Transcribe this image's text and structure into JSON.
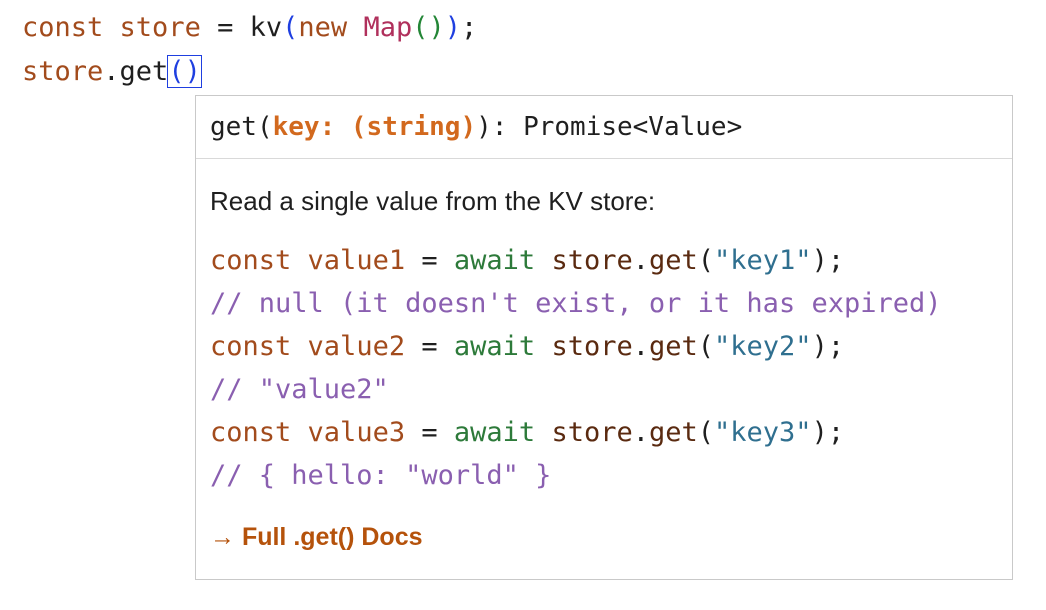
{
  "editor": {
    "line1": {
      "kw": "const",
      "var": "store",
      "eq": "=",
      "fn": "kv",
      "open_paren": "(",
      "new_kw": "new",
      "class_name": "Map",
      "inner_parens": "()",
      "close_paren": ")",
      "semicolon": ";"
    },
    "line2": {
      "obj": "store",
      "dot": ".",
      "method": "get",
      "parens": "()"
    }
  },
  "popup": {
    "signature": {
      "prefix": "get(",
      "param": "key: (string)",
      "suffix": "): Promise<Value>"
    },
    "description": "Read a single value from the KV store:",
    "example_lines": [
      {
        "type": "code",
        "kw": "const",
        "var": "value1",
        "eq": "=",
        "await": "await",
        "obj": "store",
        "dot": ".",
        "method": "get",
        "open": "(",
        "str": "\"key1\"",
        "close": ");"
      },
      {
        "type": "comment",
        "text": "// null (it doesn't exist, or it has expired)"
      },
      {
        "type": "code",
        "kw": "const",
        "var": "value2",
        "eq": "=",
        "await": "await",
        "obj": "store",
        "dot": ".",
        "method": "get",
        "open": "(",
        "str": "\"key2\"",
        "close": ");"
      },
      {
        "type": "comment",
        "text": "// \"value2\""
      },
      {
        "type": "code",
        "kw": "const",
        "var": "value3",
        "eq": "=",
        "await": "await",
        "obj": "store",
        "dot": ".",
        "method": "get",
        "open": "(",
        "str": "\"key3\"",
        "close": ");"
      },
      {
        "type": "comment",
        "text": "// { hello: \"world\" }"
      }
    ],
    "docs_link": "→ Full .get() Docs"
  },
  "colors": {
    "keyword": "#a24b1c",
    "param_highlight": "#d2691e",
    "await": "#2d7a3a",
    "string": "#2f6f8f",
    "comment": "#8a5fb0",
    "link": "#b5520b",
    "bracket_blue": "#1f3fe0",
    "bracket_green": "#238636",
    "class_name": "#b0305c"
  }
}
